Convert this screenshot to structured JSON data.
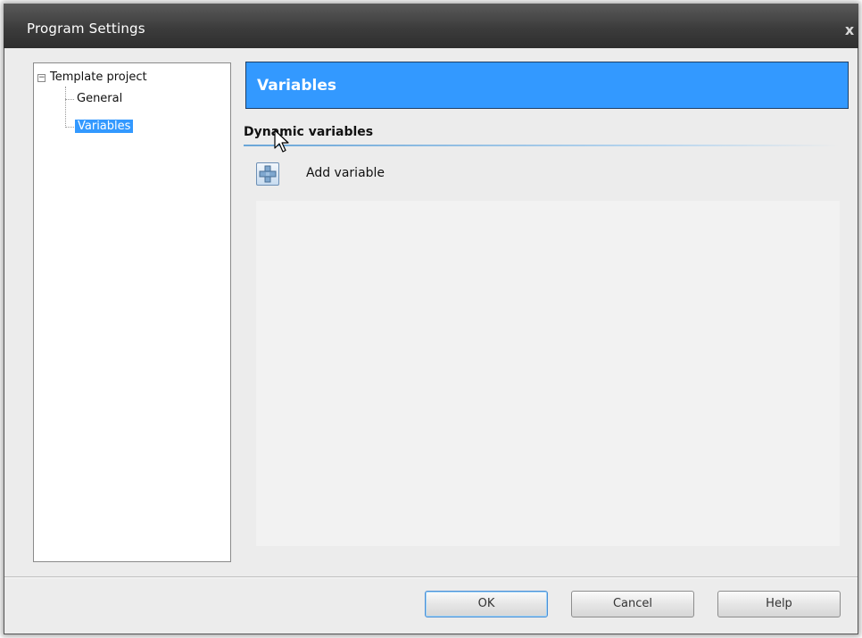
{
  "window": {
    "title": "Program Settings",
    "close_label": "x"
  },
  "tree": {
    "root": {
      "label": "Template project",
      "expander": "−"
    },
    "children": [
      {
        "label": "General",
        "selected": false
      },
      {
        "label": "Variables",
        "selected": true
      }
    ]
  },
  "panel": {
    "header": "Variables",
    "section_title": "Dynamic variables",
    "add_button_label": "Add variable"
  },
  "buttons": {
    "ok": "OK",
    "cancel": "Cancel",
    "help": "Help"
  },
  "colors": {
    "accent": "#3399ff",
    "titlebar": "#3c3c3c"
  }
}
